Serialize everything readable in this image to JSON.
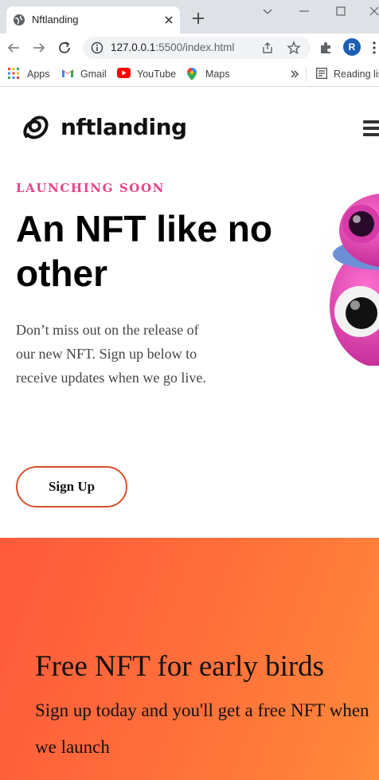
{
  "browser": {
    "tab_title": "Nftlanding",
    "url_host": "127.0.0.1",
    "url_rest": ":5500/index.html",
    "profile_initial": "R",
    "bookmarks": [
      {
        "label": "Apps",
        "icon": "apps-grid-icon"
      },
      {
        "label": "Gmail",
        "icon": "gmail-icon"
      },
      {
        "label": "YouTube",
        "icon": "youtube-icon"
      },
      {
        "label": "Maps",
        "icon": "maps-pin-icon"
      }
    ],
    "reading_list_label": "Reading lis"
  },
  "site": {
    "logo_text": "nftlanding"
  },
  "hero": {
    "eyebrow": "LAUNCHING SOON",
    "title": "An NFT like no other",
    "text": "Don’t miss out on the release of our new NFT. Sign up below to receive updates when we go live.",
    "button_label": "Sign Up"
  },
  "cta": {
    "title": "Free NFT for early birds",
    "subtitle": "Sign up today and you'll get a free NFT when we launch"
  },
  "colors": {
    "eyebrow": "#e8428c",
    "button_border": "#d4532b",
    "cta_gradient_start": "#ff5a3c",
    "cta_gradient_end": "#ff8a3a"
  }
}
